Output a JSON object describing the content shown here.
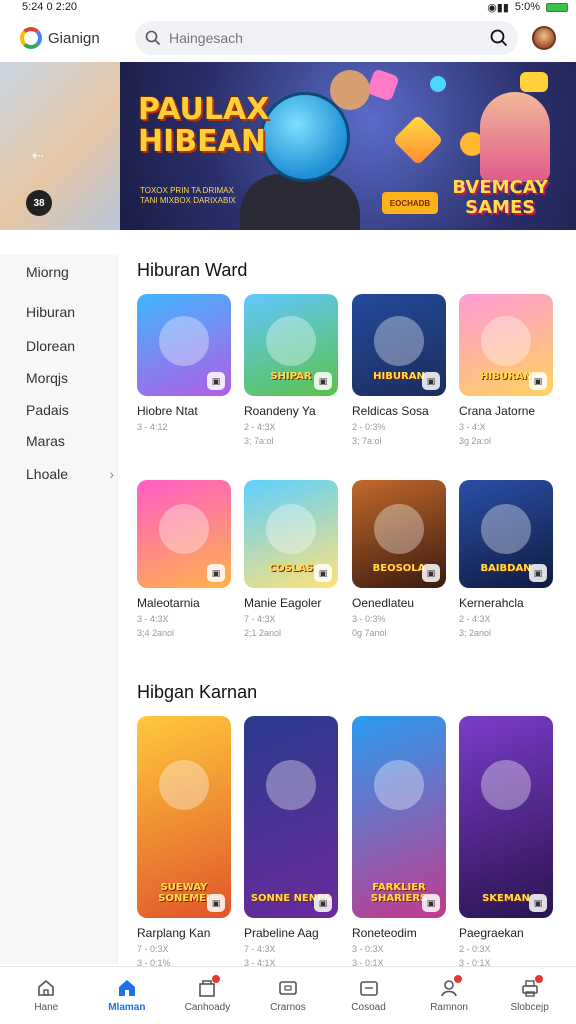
{
  "status_bar": {
    "time": "5:24 0 2:20",
    "battery_text": "5:0%"
  },
  "header": {
    "logo_text": "Gianign",
    "search": {
      "placeholder": "Haingesach"
    }
  },
  "banner": {
    "title_line1": "PAULAX",
    "title_line2": "HIBEAN",
    "subtitle_line1": "TOXOX PRIN TA DRIMAX",
    "subtitle_line2": "TANI MIXBOX DARIXABIX",
    "cta": "EOCHADB",
    "right_line1": "BVEMCAY",
    "right_line2": "SAMES",
    "side_arrow": "⇠",
    "side_chip": "38"
  },
  "sidebar": {
    "items": [
      {
        "label": "Miorng"
      },
      {
        "label": "Hiburan"
      },
      {
        "label": "Dlorean"
      },
      {
        "label": "Morqjs"
      },
      {
        "label": "Padais"
      },
      {
        "label": "Maras"
      },
      {
        "label": "Lhoale"
      }
    ]
  },
  "sections": [
    {
      "title": "Hiburan Ward",
      "rows": [
        [
          {
            "title": "Hiobre Ntat",
            "meta1": "3 - 4:12",
            "meta2": "",
            "image_label": "",
            "colors": [
              "#3fb6ff",
              "#b35de6"
            ]
          },
          {
            "title": "Roandeny Ya",
            "meta1": "2 - 4:3X",
            "meta2": "3; 7a:ol",
            "image_label": "SHIPAR",
            "colors": [
              "#61c8ff",
              "#5bc24a"
            ]
          },
          {
            "title": "Reldicas Sosa",
            "meta1": "2 - 0:3%",
            "meta2": "3; 7a:ol",
            "image_label": "HIBURAN",
            "colors": [
              "#234a9c",
              "#1b2d5c"
            ]
          },
          {
            "title": "Crana Jatorne",
            "meta1": "3 - 4:X",
            "meta2": "3g 2a:ol",
            "image_label": "HIBURAN",
            "colors": [
              "#ff9ad8",
              "#ffd35c"
            ]
          }
        ],
        [
          {
            "title": "Maleotarnia",
            "meta1": "3 - 4:3X",
            "meta2": "3;4 2anol",
            "image_label": "",
            "colors": [
              "#ff5cc8",
              "#ffb34a"
            ]
          },
          {
            "title": "Manie Eagoler",
            "meta1": "7 - 4:3X",
            "meta2": "2;1 2anol",
            "image_label": "COSLAS",
            "colors": [
              "#5cd0ff",
              "#ffe27a"
            ]
          },
          {
            "title": "Oenedlateu",
            "meta1": "3 - 0:3%",
            "meta2": "0g 7anol",
            "image_label": "BEOSOLA",
            "colors": [
              "#c2692b",
              "#3a1a10"
            ]
          },
          {
            "title": "Kernerahcla",
            "meta1": "2 - 4:3X",
            "meta2": "3; 2anol",
            "image_label": "BAIBDAN",
            "colors": [
              "#2a4fa8",
              "#0f1b3f"
            ]
          }
        ]
      ]
    },
    {
      "title": "Hibgan Karnan",
      "rows": [
        [
          {
            "title": "Rarplang Kan",
            "meta1": "7 - 0:3X",
            "meta2": "3 - 0:1%",
            "image_label": "SUEWAY SONEMEI",
            "colors": [
              "#ffc93c",
              "#e0562a"
            ]
          },
          {
            "title": "Prabeline Aag",
            "meta1": "7 - 4:3X",
            "meta2": "3 - 4:1X",
            "image_label": "SONNE NENES",
            "colors": [
              "#2a3b8c",
              "#6a2a9c"
            ]
          },
          {
            "title": "Roneteodim",
            "meta1": "3 - 0:3X",
            "meta2": "3 - 0:1X",
            "image_label": "FARKLIER SHARIERS",
            "colors": [
              "#2a9cf0",
              "#c23a8c"
            ]
          },
          {
            "title": "Paegraekan",
            "meta1": "2 - 0:3X",
            "meta2": "3 - 0:1X",
            "image_label": "SKEMAN",
            "colors": [
              "#7a3cc9",
              "#2a1450"
            ]
          }
        ]
      ]
    }
  ],
  "bottom_nav": [
    {
      "label": "Hane",
      "icon": "home-outline-icon",
      "active": false,
      "dot": false
    },
    {
      "label": "Mlaman",
      "icon": "home-filled-icon",
      "active": true,
      "dot": false
    },
    {
      "label": "Canhoady",
      "icon": "store-icon",
      "active": false,
      "dot": true
    },
    {
      "label": "Crarnos",
      "icon": "tv-icon",
      "active": false,
      "dot": false
    },
    {
      "label": "Cosoad",
      "icon": "gamepad-icon",
      "active": false,
      "dot": false
    },
    {
      "label": "Ramnon",
      "icon": "user-icon",
      "active": false,
      "dot": true
    },
    {
      "label": "Slobcejp",
      "icon": "printer-icon",
      "active": false,
      "dot": true
    }
  ]
}
